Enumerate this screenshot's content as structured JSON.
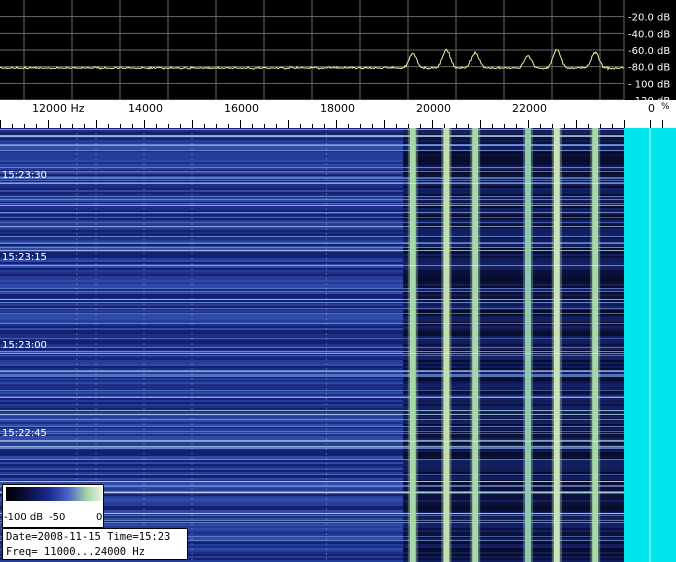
{
  "chart_data": {
    "type": "spectrogram",
    "x_unit": "Hz",
    "xlim": [
      11000,
      24000
    ],
    "x_ticks": [
      {
        "value": 12000,
        "label": "12000  Hz"
      },
      {
        "value": 14000,
        "label": "14000"
      },
      {
        "value": 16000,
        "label": "16000"
      },
      {
        "value": 18000,
        "label": "18000"
      },
      {
        "value": 20000,
        "label": "20000"
      },
      {
        "value": 22000,
        "label": "22000"
      }
    ],
    "spectrum": {
      "y_unit": "dB",
      "ylim": [
        -120,
        0
      ],
      "y_ticks": [
        {
          "value": -20,
          "label": "-20.0 dB"
        },
        {
          "value": -40,
          "label": "-40.0 dB"
        },
        {
          "value": -60,
          "label": "-60.0 dB"
        },
        {
          "value": -80,
          "label": "-80.0 dB"
        },
        {
          "value": -100,
          "label": "- 100 dB"
        },
        {
          "value": -120,
          "label": "- 120 dB"
        }
      ],
      "noise_floor_db": -83,
      "peaks": [
        {
          "freq": 19600,
          "level_db": -65
        },
        {
          "freq": 20300,
          "level_db": -60
        },
        {
          "freq": 20900,
          "level_db": -63
        },
        {
          "freq": 22000,
          "level_db": -68
        },
        {
          "freq": 22600,
          "level_db": -60
        },
        {
          "freq": 23400,
          "level_db": -63
        }
      ],
      "line_color": "#f0f0a0",
      "grid": true
    },
    "waterfall": {
      "time_labels": [
        "15:23:30",
        "15:23:15",
        "15:23:00",
        "15:22:45"
      ],
      "signal_lines": [
        {
          "freq": 19600,
          "color": "#a8d8a8"
        },
        {
          "freq": 20300,
          "color": "#c0e0b0"
        },
        {
          "freq": 20900,
          "color": "#a8d8a8"
        },
        {
          "freq": 22000,
          "color": "#90c8b0"
        },
        {
          "freq": 22600,
          "color": "#c8e4b8"
        },
        {
          "freq": 23400,
          "color": "#a8d8a8"
        }
      ],
      "background_color": "#1a2a7a",
      "highlight_color": "#00e5ee"
    },
    "level_meter": {
      "label": "0",
      "unit": "%"
    },
    "legend": {
      "ticks": [
        {
          "value": -100,
          "label": "-100 dB"
        },
        {
          "value": -50,
          "label": "-50"
        },
        {
          "value": 0,
          "label": "0"
        }
      ]
    },
    "info": {
      "line1": "Date=2008-11-15 Time=15:23",
      "line2": "Freq= 11000...24000 Hz"
    }
  }
}
